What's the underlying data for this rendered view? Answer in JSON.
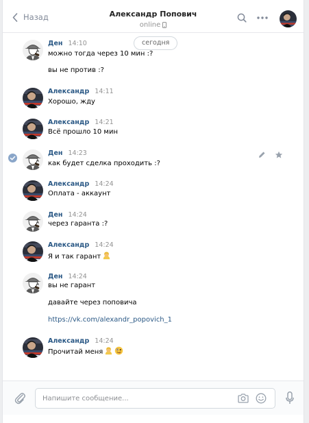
{
  "header": {
    "back_label": "Назад",
    "title": "Александр Попович",
    "status": "online"
  },
  "date_divider": "сегодня",
  "messages": [
    {
      "author": "Ден",
      "time": "14:10",
      "avatar": "den",
      "lines": [
        "можно тогда через 10 мин :?",
        "вы не против :?"
      ]
    },
    {
      "author": "Александр",
      "time": "14:11",
      "avatar": "alex",
      "lines": [
        "Хорошо, жду"
      ]
    },
    {
      "author": "Александр",
      "time": "14:21",
      "avatar": "alex",
      "lines": [
        "Всё прошло 10 мин"
      ]
    },
    {
      "author": "Ден",
      "time": "14:23",
      "avatar": "den",
      "lines": [
        "как будет сделка проходить :?"
      ],
      "selected": true
    },
    {
      "author": "Александр",
      "time": "14:24",
      "avatar": "alex",
      "lines": [
        "Оплата - аккаунт"
      ]
    },
    {
      "author": "Ден",
      "time": "14:24",
      "avatar": "den",
      "lines": [
        "через гаранта :?"
      ]
    },
    {
      "author": "Александр",
      "time": "14:24",
      "avatar": "alex",
      "lines": [
        "Я и так гарант"
      ],
      "emoji": [
        "person-blond-emoji"
      ]
    },
    {
      "author": "Ден",
      "time": "14:24",
      "avatar": "den",
      "lines": [
        "вы не гарант",
        "давайте через поповича",
        "https://vk.com/alexandr_popovich_1"
      ]
    },
    {
      "author": "Александр",
      "time": "14:24",
      "avatar": "alex",
      "lines": [
        "Прочитай меня"
      ],
      "emoji": [
        "person-blond-emoji",
        "zany-face-emoji"
      ]
    }
  ],
  "composer": {
    "placeholder": "Напишите сообщение..."
  },
  "colors": {
    "link": "#2a5885",
    "muted": "#939393",
    "background": "#edeef0",
    "selected_check": "#8aa6c9"
  },
  "icons": [
    "chevron-left-icon",
    "phone-icon",
    "search-icon",
    "more-icon",
    "pencil-icon",
    "star-icon",
    "check-icon",
    "paperclip-icon",
    "camera-icon",
    "smile-icon",
    "microphone-icon"
  ]
}
